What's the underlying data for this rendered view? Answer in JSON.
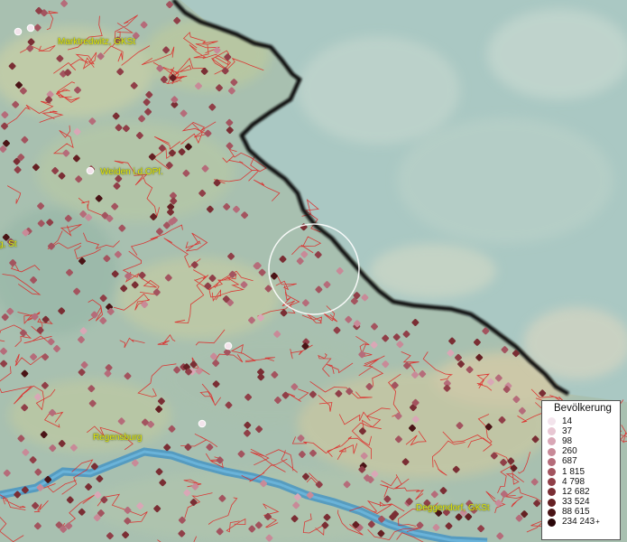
{
  "map": {
    "cities": [
      {
        "name": "Marktredwitz, GKSt",
        "id": "marktredwitz"
      },
      {
        "name": "Weiden i.d.OPf.",
        "id": "weiden"
      },
      {
        "name": "g, St",
        "id": "edge-city"
      },
      {
        "name": "Regensburg",
        "id": "regensburg"
      },
      {
        "name": "Deggendorf, GKSt",
        "id": "deggendorf"
      }
    ]
  },
  "legend": {
    "title": "Bevölkerung",
    "entries": [
      {
        "label": "14",
        "color": "#f3e4ec"
      },
      {
        "label": "37",
        "color": "#e8c7d3"
      },
      {
        "label": "98",
        "color": "#d9a7b6"
      },
      {
        "label": "260",
        "color": "#c88a98"
      },
      {
        "label": "687",
        "color": "#b56c7a"
      },
      {
        "label": "1 815",
        "color": "#a3545f"
      },
      {
        "label": "4 798",
        "color": "#903f48"
      },
      {
        "label": "12 682",
        "color": "#7a2e34"
      },
      {
        "label": "33 524",
        "color": "#652023"
      },
      {
        "label": "88 615",
        "color": "#4a1416"
      },
      {
        "label": "234 243",
        "color": "#2a0709"
      }
    ],
    "last_suffix": "+"
  },
  "colors": {
    "border": "#111111",
    "municipal_lines": "#e02020",
    "river": "#3a8fc6",
    "highlight_circle": "#ffffff"
  }
}
